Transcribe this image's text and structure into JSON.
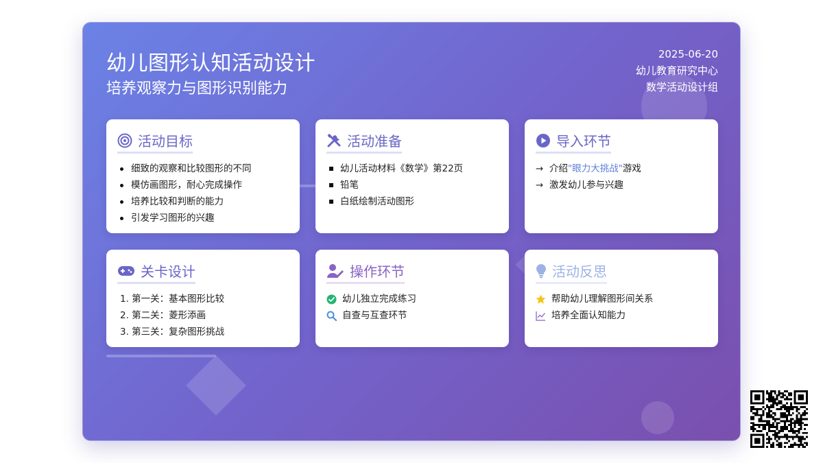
{
  "header": {
    "title": "幼儿图形认知活动设计",
    "subtitle": "培养观察力与图形识别能力",
    "date": "2025-06-20",
    "organization": "幼儿教育研究中心",
    "group": "数学活动设计组"
  },
  "cards": {
    "goals": {
      "title": "活动目标",
      "icon": "target-icon",
      "items": [
        "细致的观察和比较图形的不同",
        "模仿画图形，耐心完成操作",
        "培养比较和判断的能力",
        "引发学习图形的兴趣"
      ]
    },
    "prep": {
      "title": "活动准备",
      "icon": "tools-icon",
      "items": [
        "幼儿活动材料《数学》第22页",
        "铅笔",
        "白纸绘制活动图形"
      ]
    },
    "intro": {
      "title": "导入环节",
      "icon": "play-icon",
      "arrow": "→",
      "item1_prefix": "介绍",
      "item1_highlight": "\"眼力大挑战\"",
      "item1_suffix": "游戏",
      "item2": "激发幼儿参与兴趣"
    },
    "levels": {
      "title": "关卡设计",
      "icon": "gamepad-icon",
      "items": [
        "1. 第一关：基本图形比较",
        "2. 第二关：菱形添画",
        "3. 第三关：复杂图形挑战"
      ]
    },
    "operation": {
      "title": "操作环节",
      "icon": "user-edit-icon",
      "items": [
        {
          "icon": "check-circle-icon",
          "text": "幼儿独立完成练习"
        },
        {
          "icon": "search-icon",
          "text": "自查与互查环节"
        }
      ]
    },
    "reflection": {
      "title": "活动反思",
      "icon": "lightbulb-icon",
      "items": [
        {
          "icon": "star-icon",
          "text": "帮助幼儿理解图形间关系"
        },
        {
          "icon": "chart-line-icon",
          "text": "培养全面认知能力"
        }
      ]
    }
  },
  "colors": {
    "gradient_start": "#6b82e6",
    "gradient_end": "#7a4fae",
    "card_title": "#6a66c8",
    "highlight": "#5b7fd8",
    "check": "#22b573",
    "star": "#f5c518"
  }
}
